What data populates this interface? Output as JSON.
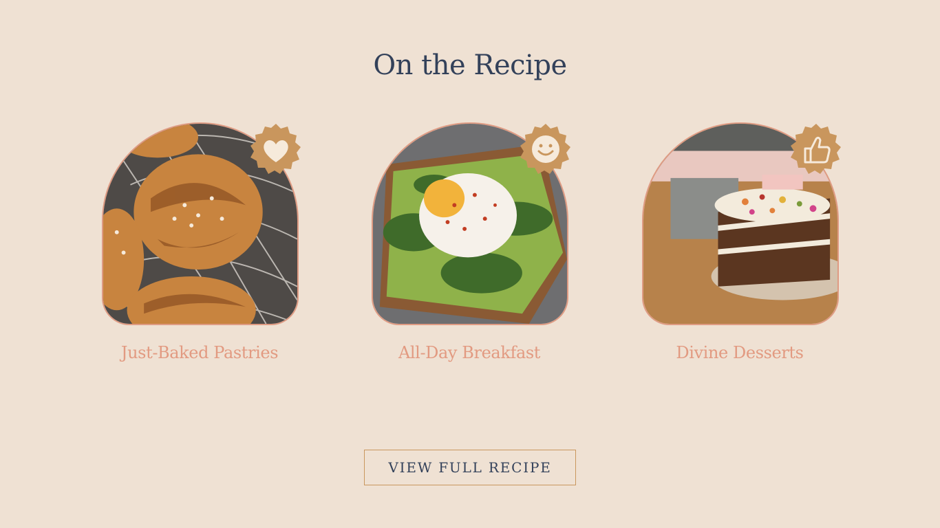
{
  "section": {
    "title": "On the Recipe"
  },
  "cards": [
    {
      "label": "Just-Baked Pastries",
      "image": "pastries-photo",
      "badge_icon": "heart-icon"
    },
    {
      "label": "All-Day Breakfast",
      "image": "poached-egg-toast-photo",
      "badge_icon": "smiley-icon"
    },
    {
      "label": "Divine Desserts",
      "image": "layer-cake-photo",
      "badge_icon": "thumbs-up-icon"
    }
  ],
  "cta": {
    "label": "VIEW FULL RECIPE"
  },
  "colors": {
    "background": "#efe1d3",
    "heading": "#33415a",
    "accent_label": "#e29a81",
    "badge": "#c9965d",
    "button_border": "#c9965d"
  }
}
